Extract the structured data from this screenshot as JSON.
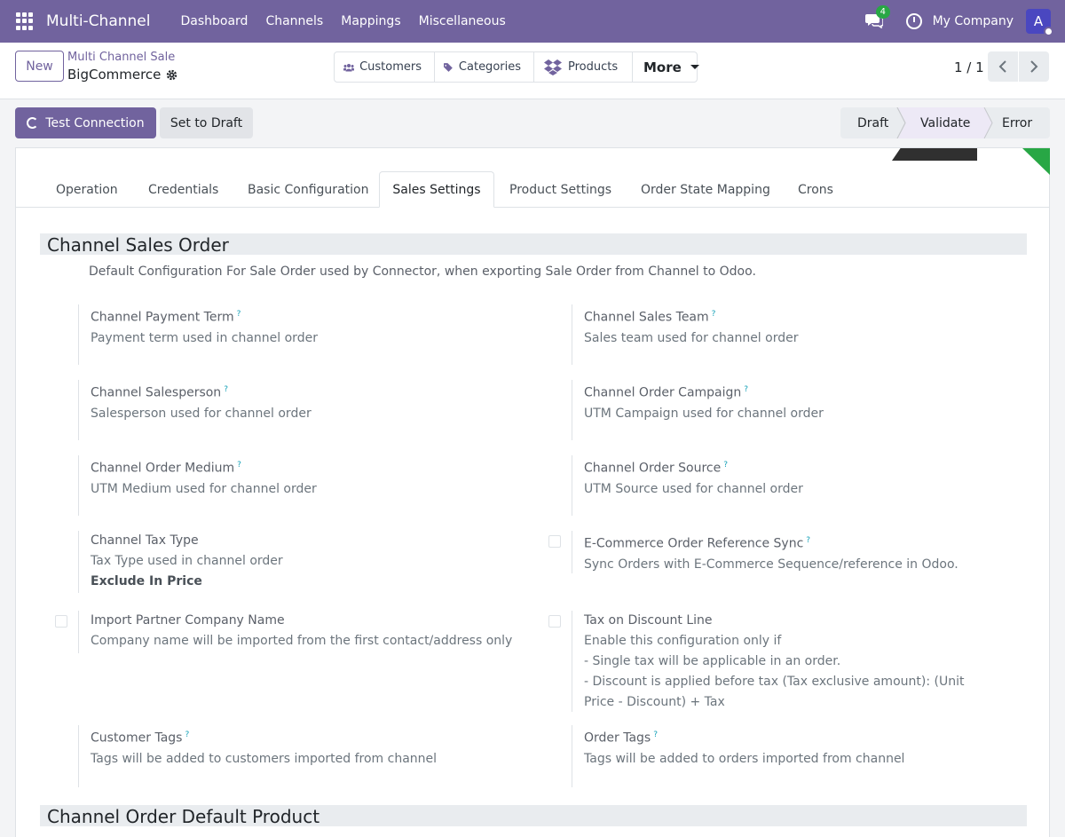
{
  "navbar": {
    "brand": "Multi-Channel",
    "menu": [
      "Dashboard",
      "Channels",
      "Mappings",
      "Miscellaneous"
    ],
    "chat_badge": "4",
    "company": "My Company",
    "avatar_initial": "A"
  },
  "control": {
    "new_label": "New",
    "breadcrumb_parent": "Multi Channel Sale",
    "breadcrumb_current": "BigCommerce",
    "smart_buttons": [
      "Customers",
      "Categories",
      "Products",
      "More"
    ],
    "pager": "1 / 1"
  },
  "statusbar": {
    "test_label": "Test Connection",
    "draft_label": "Set to Draft",
    "stages": [
      "Draft",
      "Validate",
      "Error"
    ],
    "active_stage": "Validate"
  },
  "tabs": [
    "Operation",
    "Credentials",
    "Basic Configuration",
    "Sales Settings",
    "Product Settings",
    "Order State Mapping",
    "Crons"
  ],
  "active_tab": "Sales Settings",
  "section1": {
    "title": "Channel Sales Order",
    "description": "Default Configuration For Sale Order used by Connector, when exporting Sale Order from Channel to Odoo."
  },
  "fields": {
    "payment_term": {
      "label": "Channel Payment Term",
      "help": "Payment term used in channel order"
    },
    "sales_team": {
      "label": "Channel Sales Team",
      "help": "Sales team used for channel order"
    },
    "salesperson": {
      "label": "Channel Salesperson",
      "help": "Salesperson used for channel order"
    },
    "campaign": {
      "label": "Channel Order Campaign",
      "help": "UTM Campaign used for channel order"
    },
    "medium": {
      "label": "Channel Order Medium",
      "help": "UTM Medium used for channel order"
    },
    "source": {
      "label": "Channel Order Source",
      "help": "UTM Source used for channel order"
    },
    "tax_type": {
      "label": "Channel Tax Type",
      "help": "Tax Type used in channel order",
      "value": "Exclude In Price"
    },
    "ecom_ref": {
      "label": "E-Commerce Order Reference Sync",
      "help": "Sync Orders with E-Commerce Sequence/reference in Odoo."
    },
    "partner_company": {
      "label": "Import Partner Company Name",
      "help": "Company name will be imported from the first contact/address only"
    },
    "tax_discount": {
      "label": "Tax on Discount Line",
      "help1": "Enable this configuration only if",
      "help2": "- Single tax will be applicable in an order.",
      "help3": "- Discount is applied before tax (Tax exclusive amount): (Unit Price - Discount) + Tax"
    },
    "customer_tags": {
      "label": "Customer Tags",
      "help": "Tags will be added to customers imported from channel"
    },
    "order_tags": {
      "label": "Order Tags",
      "help": "Tags will be added to orders imported from channel"
    }
  },
  "section2": {
    "title": "Channel Order Default Product"
  },
  "help_marker": "?",
  "colors": {
    "primary": "#71639e",
    "ribbon": "#28a745",
    "badge": "#28a745"
  }
}
